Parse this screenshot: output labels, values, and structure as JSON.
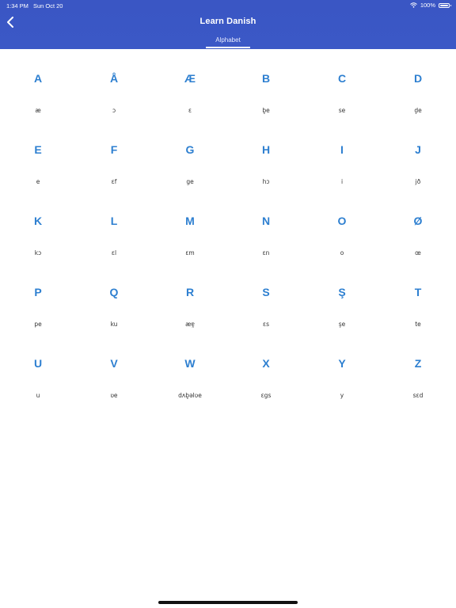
{
  "status": {
    "time": "1:34 PM",
    "date": "Sun Oct 20",
    "battery": "100%"
  },
  "header": {
    "title": "Learn Danish",
    "tab": "Alphabet"
  },
  "letters": [
    {
      "letter": "A",
      "pron": "æ"
    },
    {
      "letter": "Å",
      "pron": "ɔ"
    },
    {
      "letter": "Æ",
      "pron": "ɛ"
    },
    {
      "letter": "B",
      "pron": "b̥e"
    },
    {
      "letter": "C",
      "pron": "se"
    },
    {
      "letter": "D",
      "pron": "d̥e"
    },
    {
      "letter": "E",
      "pron": "e"
    },
    {
      "letter": "F",
      "pron": "ɛf"
    },
    {
      "letter": "G",
      "pron": "ge"
    },
    {
      "letter": "H",
      "pron": "hɔ"
    },
    {
      "letter": "I",
      "pron": "i"
    },
    {
      "letter": "J",
      "pron": "jð"
    },
    {
      "letter": "K",
      "pron": "kɔ"
    },
    {
      "letter": "L",
      "pron": "ɛl"
    },
    {
      "letter": "M",
      "pron": "ɛm"
    },
    {
      "letter": "N",
      "pron": "ɛn"
    },
    {
      "letter": "O",
      "pron": "o"
    },
    {
      "letter": "Ø",
      "pron": "œ"
    },
    {
      "letter": "P",
      "pron": "pe"
    },
    {
      "letter": "Q",
      "pron": "ku"
    },
    {
      "letter": "R",
      "pron": "æɐ̯"
    },
    {
      "letter": "S",
      "pron": "ɛs"
    },
    {
      "letter": "Ş",
      "pron": "şe"
    },
    {
      "letter": "T",
      "pron": "te"
    },
    {
      "letter": "U",
      "pron": "u"
    },
    {
      "letter": "V",
      "pron": "ʋe"
    },
    {
      "letter": "W",
      "pron": "dʌb̥əlʋe"
    },
    {
      "letter": "X",
      "pron": "ɛgs"
    },
    {
      "letter": "Y",
      "pron": "y"
    },
    {
      "letter": "Z",
      "pron": "sɛd"
    }
  ],
  "colors": {
    "header": "#3a56c4",
    "letter": "#2d7fd0"
  },
  "icons": {
    "back": "chevron-left-icon",
    "wifi": "wifi-icon",
    "battery": "battery-icon"
  }
}
